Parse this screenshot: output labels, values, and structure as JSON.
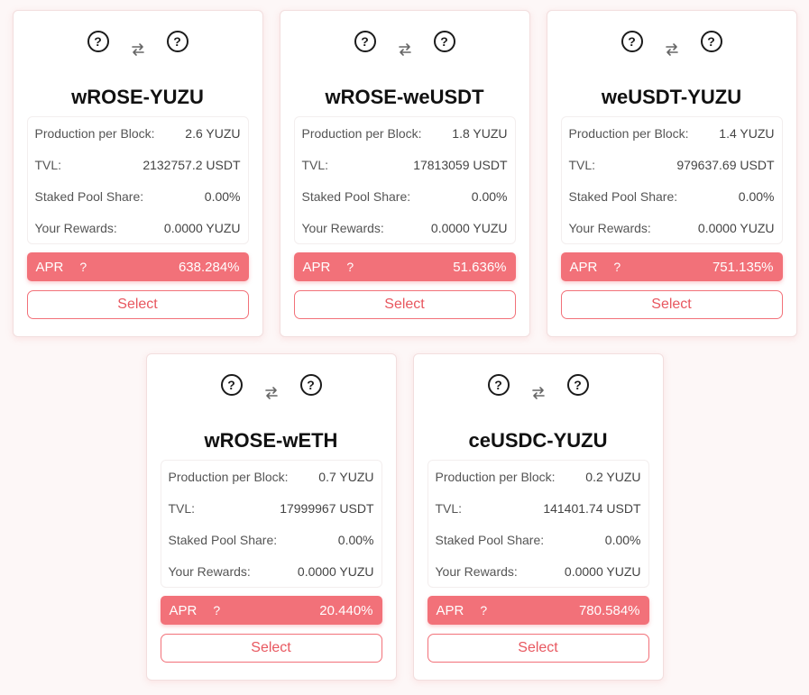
{
  "labels": {
    "production": "Production per Block:",
    "tvl": "TVL:",
    "share": "Staked Pool Share:",
    "rewards": "Your Rewards:",
    "apr": "APR",
    "apr_help": "?",
    "select": "Select",
    "token_unknown": "?"
  },
  "colors": {
    "accent": "#f27179",
    "select_text": "#e8575f"
  },
  "pools": [
    {
      "title": "wROSE-YUZU",
      "production": "2.6 YUZU",
      "tvl": "2132757.2 USDT",
      "share": "0.00%",
      "rewards": "0.0000 YUZU",
      "apr": "638.284%"
    },
    {
      "title": "wROSE-weUSDT",
      "production": "1.8 YUZU",
      "tvl": "17813059 USDT",
      "share": "0.00%",
      "rewards": "0.0000 YUZU",
      "apr": "51.636%"
    },
    {
      "title": "weUSDT-YUZU",
      "production": "1.4 YUZU",
      "tvl": "979637.69 USDT",
      "share": "0.00%",
      "rewards": "0.0000 YUZU",
      "apr": "751.135%"
    },
    {
      "title": "wROSE-wETH",
      "production": "0.7 YUZU",
      "tvl": "17999967 USDT",
      "share": "0.00%",
      "rewards": "0.0000 YUZU",
      "apr": "20.440%"
    },
    {
      "title": "ceUSDC-YUZU",
      "production": "0.2 YUZU",
      "tvl": "141401.74 USDT",
      "share": "0.00%",
      "rewards": "0.0000 YUZU",
      "apr": "780.584%"
    }
  ]
}
